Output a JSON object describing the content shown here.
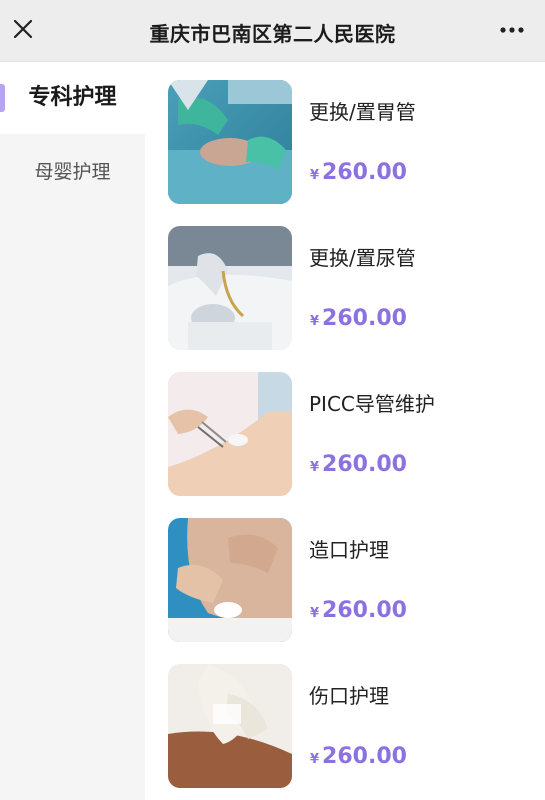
{
  "header": {
    "title": "重庆市巴南区第二人民医院",
    "close_icon": "close-icon",
    "more_icon": "more-dots-icon"
  },
  "sidebar": {
    "items": [
      {
        "label": "专科护理",
        "active": true
      },
      {
        "label": "母婴护理",
        "active": false
      }
    ]
  },
  "services": [
    {
      "title": "更换/置胃管",
      "currency": "¥",
      "price": "260.00",
      "image": "surgery-gloves-photo"
    },
    {
      "title": "更换/置尿管",
      "currency": "¥",
      "price": "260.00",
      "image": "catheter-photo"
    },
    {
      "title": "PICC导管维护",
      "currency": "¥",
      "price": "260.00",
      "image": "picc-arm-photo"
    },
    {
      "title": "造口护理",
      "currency": "¥",
      "price": "260.00",
      "image": "stoma-care-photo"
    },
    {
      "title": "伤口护理",
      "currency": "¥",
      "price": "260.00",
      "image": "wound-care-photo"
    }
  ],
  "colors": {
    "accent": "#8c72e0",
    "sidebar_indicator": "#b7a4f0",
    "header_bg": "#ededed",
    "sidebar_bg": "#f5f5f5"
  }
}
